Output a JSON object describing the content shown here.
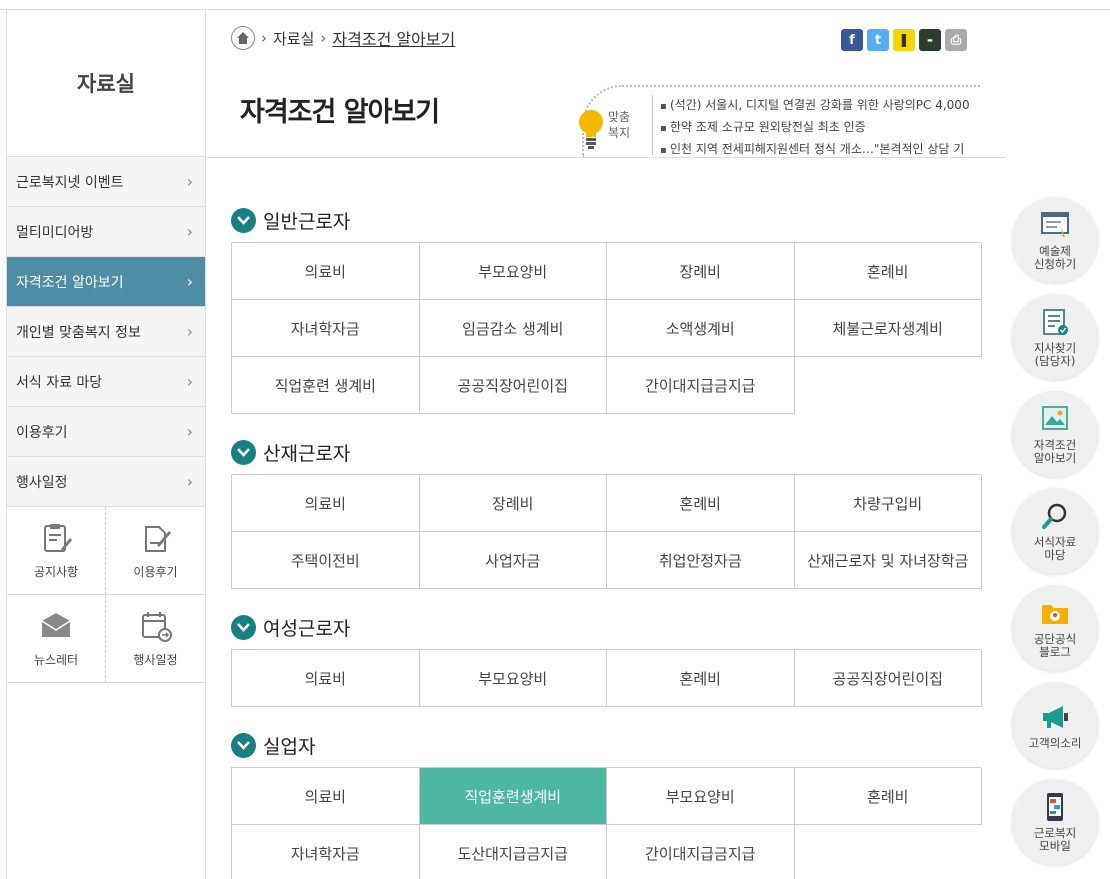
{
  "sidebar": {
    "title": "자료실",
    "items": [
      {
        "label": "근로복지넷 이벤트"
      },
      {
        "label": "멀티미디어방"
      },
      {
        "label": "자격조건 알아보기"
      },
      {
        "label": "개인별 맞춤복지 정보"
      },
      {
        "label": "서식 자료 마당"
      },
      {
        "label": "이용후기"
      },
      {
        "label": "행사일정"
      }
    ],
    "quick": [
      {
        "label": "공지사항",
        "icon": "notice-icon"
      },
      {
        "label": "이용후기",
        "icon": "review-icon"
      },
      {
        "label": "뉴스레터",
        "icon": "newsletter-icon"
      },
      {
        "label": "행사일정",
        "icon": "calendar-icon"
      }
    ]
  },
  "breadcrumb": {
    "level1": "자료실",
    "current": "자격조건 알아보기"
  },
  "page": {
    "title": "자격조건 알아보기"
  },
  "news": {
    "label_line1": "맞춤",
    "label_line2": "복지",
    "items": [
      "(석간) 서울시, 디지털 연결권 강화를 위한 사랑의PC 4,000",
      "한약 조제 소규모 원외탕전실 최초 인증",
      "인천 지역 전세피해지원센터 정식 개소…\"본격적인 상담 기"
    ]
  },
  "sections": [
    {
      "title": "일반근로자",
      "cells": [
        "의료비",
        "부모요양비",
        "장례비",
        "혼례비",
        "자녀학자금",
        "임금감소 생계비",
        "소액생계비",
        "체불근로자생계비",
        "직업훈련 생계비",
        "공공직장어린이집",
        "간이대지급금지급"
      ]
    },
    {
      "title": "산재근로자",
      "cells": [
        "의료비",
        "장례비",
        "혼례비",
        "차량구입비",
        "주택이전비",
        "사업자금",
        "취업안정자금",
        "산재근로자 및 자녀장학금"
      ]
    },
    {
      "title": "여성근로자",
      "cells": [
        "의료비",
        "부모요양비",
        "혼례비",
        "공공직장어린이집"
      ]
    },
    {
      "title": "실업자",
      "cells": [
        "의료비",
        "직업훈련생계비",
        "부모요양비",
        "혼례비",
        "자녀학자금",
        "도산대지급금지급",
        "간이대지급금지급"
      ],
      "active_cell": "직업훈련생계비"
    }
  ],
  "right_menu": [
    {
      "label": "예술제\n신청하기"
    },
    {
      "label": "지사찾기\n(담당자)"
    },
    {
      "label": "자격조건\n알아보기"
    },
    {
      "label": "서식자료\n마당"
    },
    {
      "label": "공단공식\n블로그"
    },
    {
      "label": "고객의소리"
    },
    {
      "label": "근로복지\n모바일"
    }
  ],
  "colors": {
    "active_sidebar": "#4e8ea5",
    "section_icon": "#1a7f83",
    "active_cell": "#4fb8a4"
  }
}
